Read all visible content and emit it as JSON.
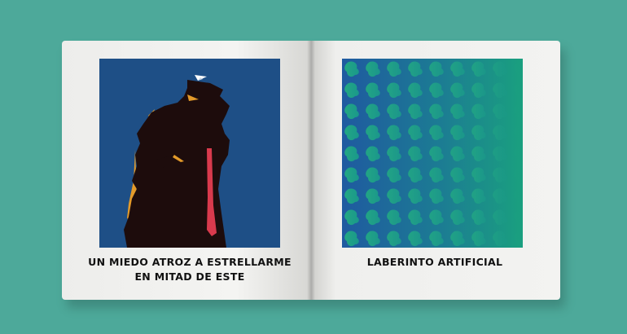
{
  "book": {
    "left_page": {
      "caption_line1": "UN MIEDO ATROZ A ESTRELLARME",
      "caption_line2": "EN MITAD DE ESTE"
    },
    "right_page": {
      "caption": "LABERINTO ARTIFICIAL"
    }
  },
  "colors": {
    "background": "#4da99a",
    "left_art_bg": "#1e4f86",
    "silhouette": "#1d0c0c",
    "tie": "#d93a4d",
    "right_art_gradient_start": "#1f5aa0",
    "right_art_gradient_end": "#1aa07f"
  }
}
